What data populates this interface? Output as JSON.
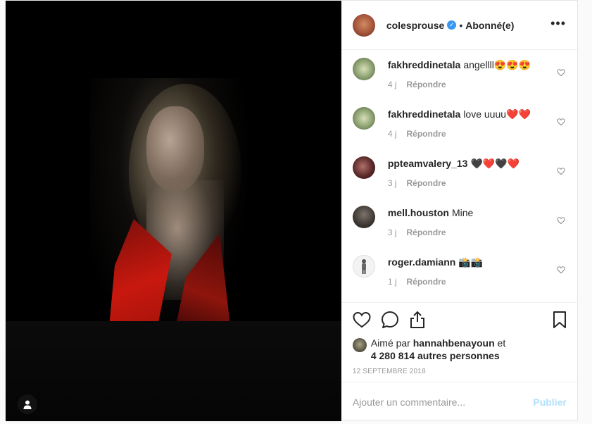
{
  "post": {
    "author": "colesprouse",
    "verified_icon": "verified-badge-icon",
    "separator": "•",
    "follow_status": "Abonné(e)",
    "more_label": "•••"
  },
  "comments": [
    {
      "user": "fakhreddinetala",
      "text": "angellll😍😍😍",
      "age": "4 j",
      "reply": "Répondre"
    },
    {
      "user": "fakhreddinetala",
      "text": "love uuuu❤️❤️",
      "age": "4 j",
      "reply": "Répondre"
    },
    {
      "user": "ppteamvalery_13",
      "text": "🖤❤️🖤❤️",
      "age": "3 j",
      "reply": "Répondre"
    },
    {
      "user": "mell.houston",
      "text": "Mine",
      "age": "3 j",
      "reply": "Répondre"
    },
    {
      "user": "roger.damiann",
      "text": "📸📸",
      "age": "1 j",
      "reply": "Répondre"
    }
  ],
  "likes": {
    "prefix": "Aimé par ",
    "user": "hannahbenayoun",
    "mid": " et",
    "others": "4 280 814 autres personnes"
  },
  "date": "12 SEPTEMBRE 2018",
  "comment_box": {
    "placeholder": "Ajouter un commentaire...",
    "publish": "Publier"
  },
  "colors": {
    "accent": "#3897f0",
    "publish_disabled": "#b2dffc",
    "text": "#262626",
    "muted": "#999999"
  }
}
